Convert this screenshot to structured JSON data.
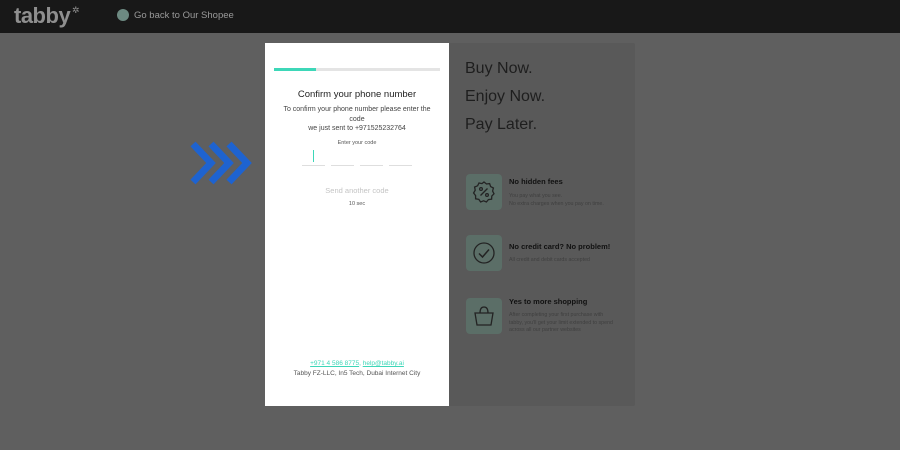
{
  "topbar": {
    "logo": "tabby",
    "back_link": "Go back to Our Shopee"
  },
  "verify_card": {
    "progress_percent": 25,
    "title": "Confirm your phone number",
    "description_line1": "To confirm your phone number please enter the code",
    "description_line2": "we just sent to +971525232764",
    "code_label": "Enter your code",
    "resend_label": "Send another code",
    "timer": "10 sec",
    "footer_phone": "+971 4 586 8775",
    "footer_separator": ",",
    "footer_email": "help@tabby.ai",
    "footer_address": "Tabby FZ-LLC, In5 Tech, Dubai Internet City"
  },
  "promo": {
    "taglines": [
      "Buy Now.",
      "Enjoy Now.",
      "Pay Later."
    ],
    "features": [
      {
        "icon": "percent-badge-icon",
        "title": "No hidden fees",
        "desc_line1": "You pay what you see.",
        "desc_line2": "No extra charges when you pay on time."
      },
      {
        "icon": "check-circle-icon",
        "title": "No credit card? No problem!",
        "desc_line1": "All credit and debit cards accepted",
        "desc_line2": ""
      },
      {
        "icon": "shopping-basket-icon",
        "title": "Yes to more shopping",
        "desc_line1": "After completing your first purchase with",
        "desc_line2": "tabby, you'll get your limit extended to spend",
        "desc_line3": "across all our partner websites"
      }
    ]
  },
  "colors": {
    "accent": "#3dd7b8",
    "brand_blue": "#1e63d0",
    "overlay": "#5f5f5f",
    "topbar": "#181818"
  }
}
